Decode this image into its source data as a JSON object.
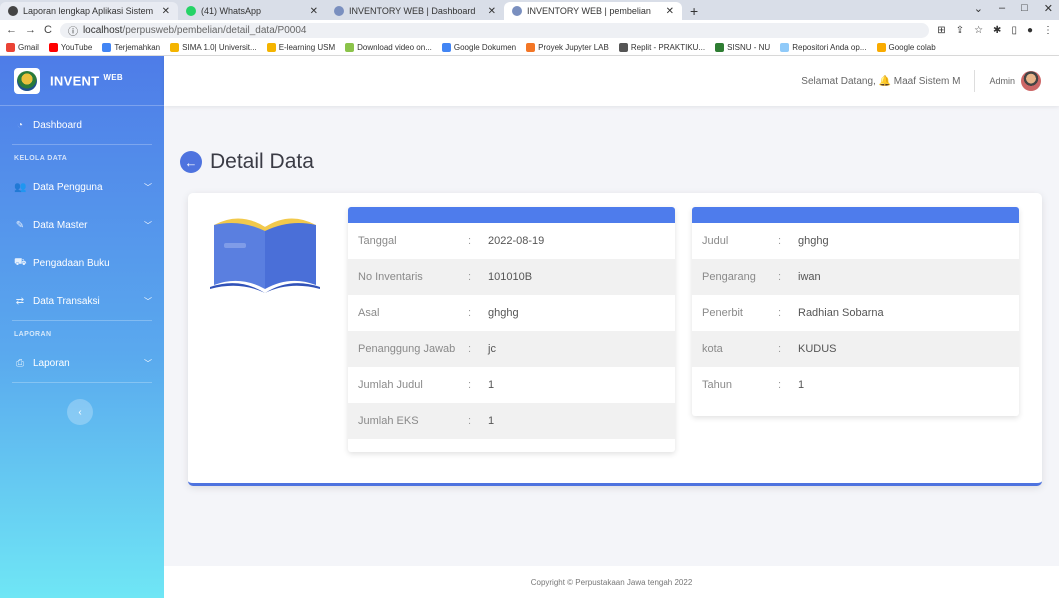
{
  "browser": {
    "tabs": [
      {
        "label": "Laporan lengkap Aplikasi Sistem",
        "color": "#444444"
      },
      {
        "label": "(41) WhatsApp",
        "color": "#25d366"
      },
      {
        "label": "INVENTORY WEB | Dashboard",
        "color": "#7a8fbf"
      },
      {
        "label": "INVENTORY WEB | pembelian",
        "color": "#7a8fbf"
      }
    ],
    "url_host": "localhost",
    "url_path": "/perpusweb/pembelian/detail_data/P0004",
    "bookmarks": [
      {
        "label": "Gmail",
        "color": "#ea4335"
      },
      {
        "label": "YouTube",
        "color": "#ff0000"
      },
      {
        "label": "Terjemahkan",
        "color": "#4285f4"
      },
      {
        "label": "SIMA 1.0| Universit...",
        "color": "#f4b400"
      },
      {
        "label": "E-learning USM",
        "color": "#f4b400"
      },
      {
        "label": "Download video on...",
        "color": "#8bc34a"
      },
      {
        "label": "Google Dokumen",
        "color": "#4285f4"
      },
      {
        "label": "Proyek Jupyter LAB",
        "color": "#f37626"
      },
      {
        "label": "Replit - PRAKTIKU...",
        "color": "#555555"
      },
      {
        "label": "SISNU - NU",
        "color": "#2e7d32"
      },
      {
        "label": "Repositori Anda op...",
        "color": "#90caf9"
      },
      {
        "label": "Google colab",
        "color": "#f9ab00"
      }
    ]
  },
  "sidebar": {
    "brand": "INVENT",
    "brand_sup": "WEB",
    "items": [
      {
        "label": "Dashboard",
        "icon": "tachometer-icon"
      },
      {
        "label": "Data Pengguna",
        "icon": "users-icon"
      },
      {
        "label": "Data Master",
        "icon": "edit-icon"
      },
      {
        "label": "Pengadaan Buku",
        "icon": "cart-icon"
      },
      {
        "label": "Data Transaksi",
        "icon": "exchange-icon"
      },
      {
        "label": "Laporan",
        "icon": "print-icon"
      }
    ],
    "heading_kelola": "KELOLA DATA",
    "heading_laporan": "LAPORAN"
  },
  "topbar": {
    "greeting": "Selamat Datang, 🔔 Maaf Sistem M",
    "user": "Admin"
  },
  "page": {
    "title": "Detail Data"
  },
  "detail_left": [
    {
      "label": "Tanggal",
      "value": "2022-08-19"
    },
    {
      "label": "No Inventaris",
      "value": "101010B"
    },
    {
      "label": "Asal",
      "value": "ghghg"
    },
    {
      "label": "Penanggung Jawab",
      "value": "jc"
    },
    {
      "label": "Jumlah Judul",
      "value": "1"
    },
    {
      "label": "Jumlah EKS",
      "value": "1"
    }
  ],
  "detail_right": [
    {
      "label": "Judul",
      "value": "ghghg"
    },
    {
      "label": "Pengarang",
      "value": "iwan"
    },
    {
      "label": "Penerbit",
      "value": "Radhian Sobarna"
    },
    {
      "label": "kota",
      "value": "KUDUS"
    },
    {
      "label": "Tahun",
      "value": "1"
    }
  ],
  "separator": ":",
  "footer": "Copyright © Perpustakaan Jawa tengah 2022",
  "colors": {
    "primary": "#4e73df",
    "panel_head": "#4e7cec"
  }
}
